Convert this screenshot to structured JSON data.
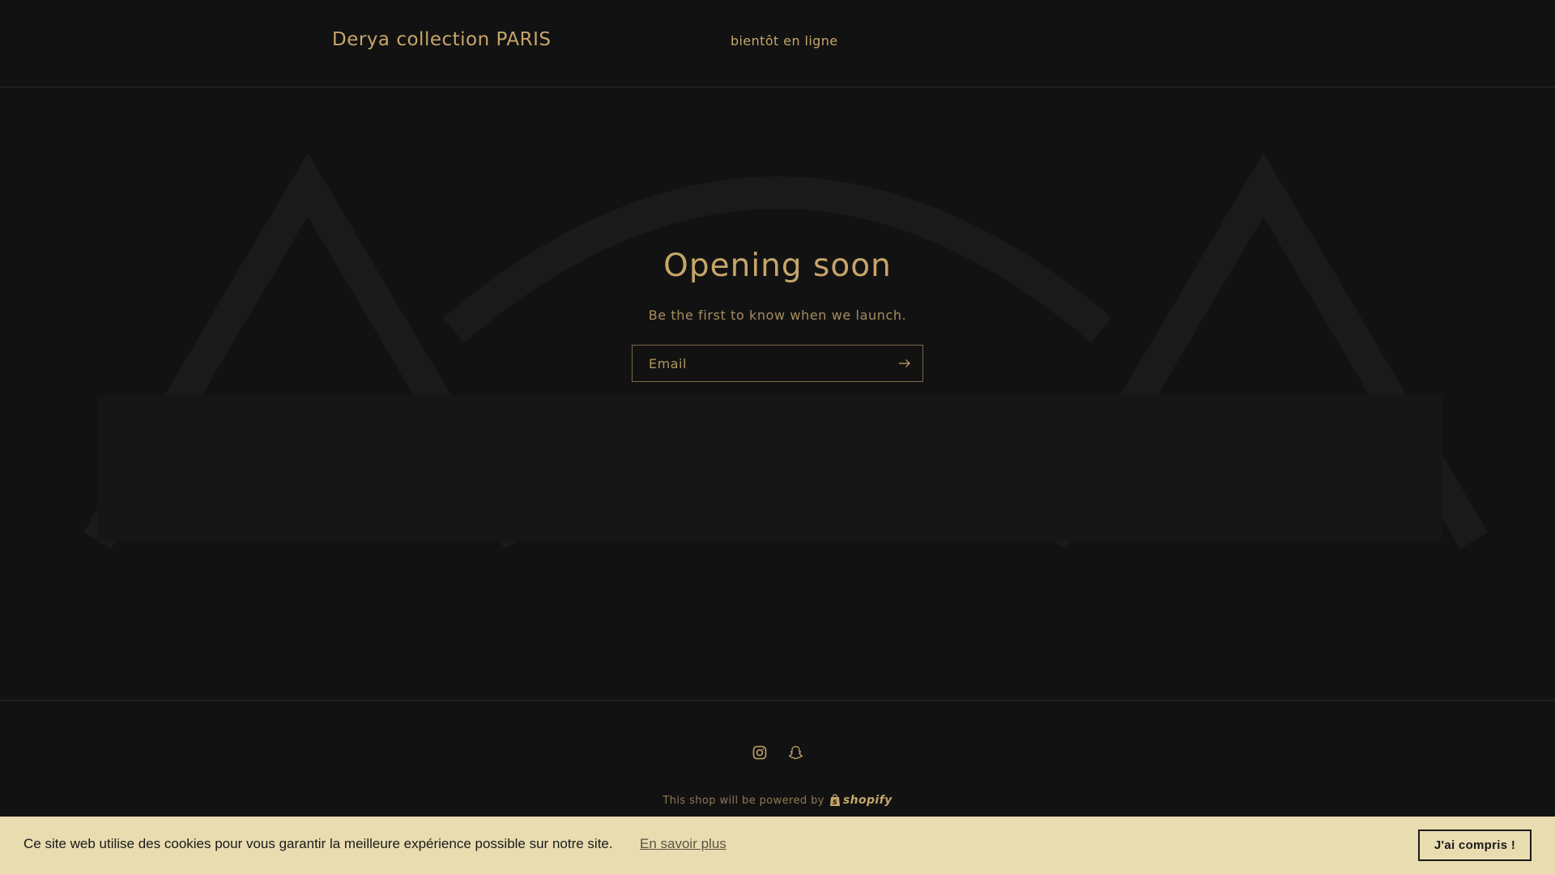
{
  "header": {
    "brand": "Derya collection PARIS",
    "nav_link": "bientôt en ligne"
  },
  "hero": {
    "title": "Opening soon",
    "subtitle": "Be the first to know when we launch.",
    "email_placeholder": "Email"
  },
  "footer": {
    "social_icons": [
      "instagram-icon",
      "snapchat-icon"
    ],
    "powered_by": "This shop will be powered by",
    "shopify_label": "shopify"
  },
  "cookie": {
    "message": "Ce site web utilise des cookies pour vous garantir la meilleure expérience possible sur notre site.",
    "learn_more": "En savoir plus",
    "accept": "J'ai compris !"
  },
  "colors": {
    "background": "#121212",
    "accent": "#c5a56a",
    "cookie_bar": "#e9dcb0"
  }
}
